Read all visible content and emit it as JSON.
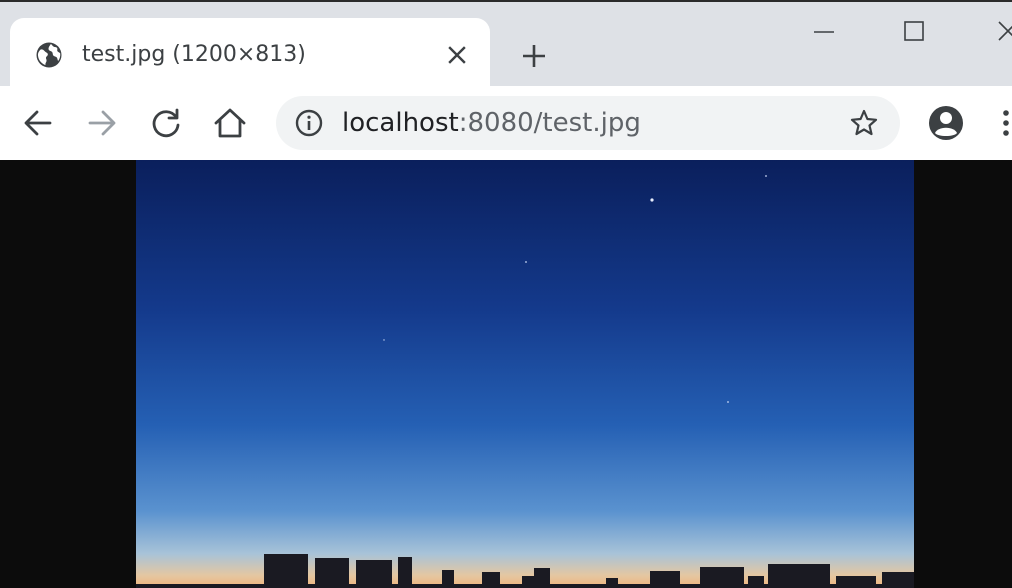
{
  "tab": {
    "title": "test.jpg (1200×813)",
    "favicon": "globe-icon"
  },
  "window_controls": {
    "minimize": "minimize-icon",
    "maximize": "maximize-icon",
    "close": "close-icon"
  },
  "toolbar": {
    "back": "back-arrow-icon",
    "forward": "forward-arrow-icon",
    "reload": "reload-icon",
    "home": "home-icon",
    "bookmark": "star-icon",
    "profile": "account-icon",
    "menu": "more-vert-icon"
  },
  "omnibox": {
    "host": "localhost",
    "rest": ":8080/test.jpg",
    "info": "info-icon"
  },
  "content": {
    "image": "night sky over city skyline",
    "sky_top_color": "#0a1f5c",
    "sky_bottom_color": "#f0b47a"
  }
}
